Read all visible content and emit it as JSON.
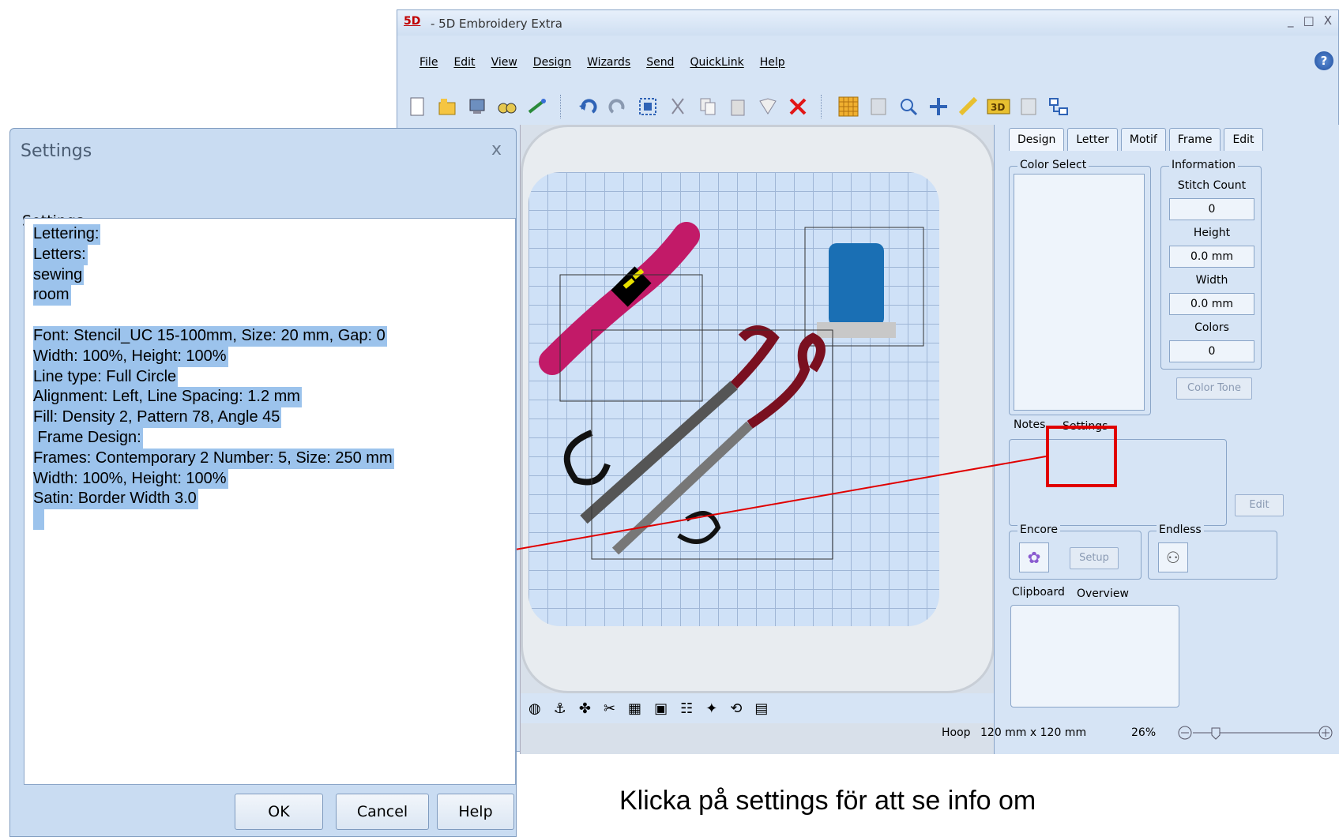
{
  "app": {
    "logo": "5D",
    "title": "- 5D Embroidery Extra",
    "window_controls": [
      "_",
      "□",
      "X"
    ],
    "menu": [
      "File",
      "Edit",
      "View",
      "Design",
      "Wizards",
      "Send",
      "QuickLink",
      "Help"
    ],
    "help_icon_glyph": "?"
  },
  "toolbar": {
    "icons": [
      "new-document-icon",
      "open-folder-icon",
      "mycomputer-icon",
      "find-icon",
      "wizard-icon",
      "undo-icon",
      "redo-icon",
      "select-icon",
      "cut-icon",
      "copy-icon",
      "paste-icon",
      "duplicate-icon",
      "delete-icon",
      "grid-icon",
      "design-view-icon",
      "zoom-icon",
      "move-icon",
      "measure-icon",
      "3d-icon",
      "properties-icon",
      "hierarchy-icon"
    ]
  },
  "panel": {
    "tabs": [
      "Design",
      "Letter",
      "Motif",
      "Frame",
      "Edit"
    ],
    "active_tab": "Design",
    "color_select_title": "Color Select",
    "information_title": "Information",
    "info": [
      {
        "label": "Stitch Count",
        "value": "0"
      },
      {
        "label": "Height",
        "value": "0.0 mm"
      },
      {
        "label": "Width",
        "value": "0.0 mm"
      },
      {
        "label": "Colors",
        "value": "0"
      }
    ],
    "color_tone_button": "Color Tone",
    "notes_tab": "Notes",
    "settings_tab": "Settings",
    "edit_button": "Edit",
    "encore_title": "Encore",
    "setup_button": "Setup",
    "endless_title": "Endless",
    "clipboard_tab": "Clipboard",
    "overview_tab": "Overview"
  },
  "status": {
    "hoop_label": "Hoop",
    "hoop_size": "120 mm x 120 mm",
    "zoom": "26%"
  },
  "dialog": {
    "title": "Settings",
    "close_glyph": "x",
    "label": "Settings:",
    "lines": [
      "Lettering:",
      "Letters:",
      "sewing",
      "room",
      "",
      "Font: Stencil_UC 15-100mm, Size: 20 mm, Gap: 0",
      "Width: 100%, Height: 100%",
      "Line type: Full Circle",
      "Alignment: Left, Line Spacing: 1.2 mm",
      "Fill: Density 2, Pattern 78, Angle 45",
      " Frame Design:",
      "Frames: Contemporary 2 Number: 5, Size: 250 mm",
      "Width: 100%, Height: 100%",
      "Satin: Border Width 3.0",
      " "
    ],
    "ok": "OK",
    "cancel": "Cancel",
    "help": "Help"
  },
  "caption": "Klicka på settings för att se info om",
  "colors": {
    "highlight": "#e00000",
    "selection": "#9cc3ec",
    "window_bg": "#d6e4f5"
  }
}
